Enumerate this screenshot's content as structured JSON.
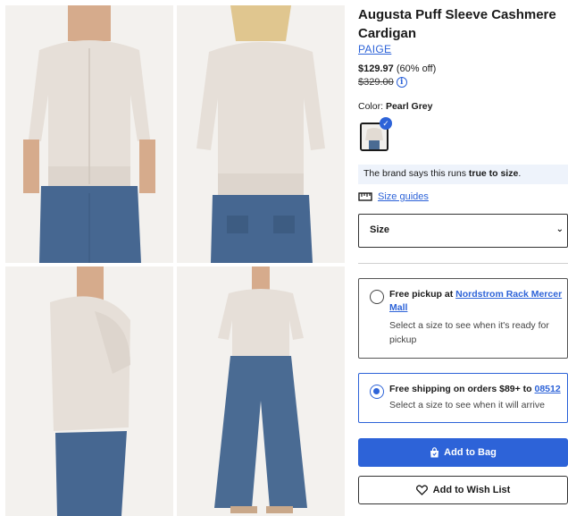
{
  "product": {
    "title": "Augusta Puff Sleeve Cashmere Cardigan",
    "brand": "PAIGE",
    "sale_price": "$129.97",
    "discount": "(60% off)",
    "original_price": "$329.00",
    "color_label": "Color:",
    "color_value": "Pearl Grey"
  },
  "fit": {
    "prefix": "The brand says this runs ",
    "emphasis": "true to size",
    "suffix": "."
  },
  "size_guide": {
    "label": "Size guides"
  },
  "size_select": {
    "label": "Size"
  },
  "fulfillment": {
    "pickup_prefix": "Free pickup at ",
    "pickup_store": "Nordstrom Rack Mercer Mall",
    "pickup_note": "Select a size to see when it's ready for pickup",
    "shipping_prefix": "Free shipping on orders $89+ to ",
    "shipping_zip": "08512",
    "shipping_note": "Select a size to see when it will arrive"
  },
  "actions": {
    "add_to_bag": "Add to Bag",
    "add_to_wishlist": "Add to Wish List"
  },
  "colors": {
    "accent": "#2d63d8",
    "sweater": "#e8e2dc",
    "denim": "#4a6b93"
  }
}
